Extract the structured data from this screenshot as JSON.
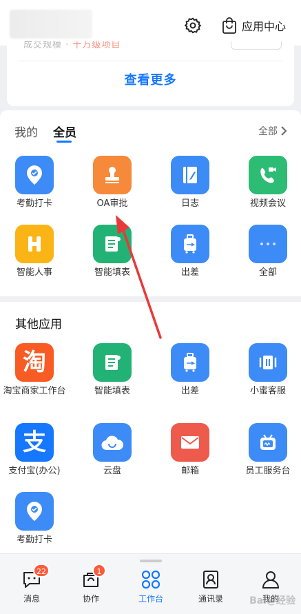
{
  "header": {
    "app_center_label": "应用中心"
  },
  "top_card": {
    "partial_text": "成交规模 · ",
    "partial_highlight": "千万级项目",
    "see_more": "查看更多"
  },
  "apps_section": {
    "tab_mine": "我的",
    "tab_all": "全员",
    "all_label": "全部",
    "apps": [
      {
        "label": "考勤打卡",
        "icon": "location-pin-icon",
        "color": "#3d8bf7"
      },
      {
        "label": "OA审批",
        "icon": "stamp-icon",
        "color": "#f7893a"
      },
      {
        "label": "日志",
        "icon": "notebook-icon",
        "color": "#3d8bf7"
      },
      {
        "label": "视频会议",
        "icon": "video-call-icon",
        "color": "#2cbc74"
      },
      {
        "label": "智能人事",
        "icon": "h-icon",
        "color": "#fbb416"
      },
      {
        "label": "智能填表",
        "icon": "form-icon",
        "color": "#22b275"
      },
      {
        "label": "出差",
        "icon": "luggage-icon",
        "color": "#3d8bf7"
      },
      {
        "label": "全部",
        "icon": "more-dots-icon",
        "color": "#3d8bf7"
      }
    ]
  },
  "other_section": {
    "title": "其他应用",
    "apps": [
      {
        "label": "淘宝商家工作台",
        "icon": "taobao-icon",
        "color": "#f95b24"
      },
      {
        "label": "智能填表",
        "icon": "form-icon",
        "color": "#22b275"
      },
      {
        "label": "出差",
        "icon": "luggage-icon",
        "color": "#3d8bf7"
      },
      {
        "label": "小蜜客服",
        "icon": "customer-service-icon",
        "color": "#3d8bf7"
      },
      {
        "label": "支付宝(办公)",
        "icon": "alipay-icon",
        "color": "#1677ff"
      },
      {
        "label": "云盘",
        "icon": "cloud-icon",
        "color": "#3d8bf7"
      },
      {
        "label": "邮箱",
        "icon": "mail-icon",
        "color": "#ee5a4c"
      },
      {
        "label": "员工服务台",
        "icon": "service-robot-icon",
        "color": "#3d8bf7"
      },
      {
        "label": "考勤打卡",
        "icon": "location-pin-icon",
        "color": "#3d8bf7"
      }
    ]
  },
  "bottom_nav": {
    "messages": {
      "label": "消息",
      "badge": "22"
    },
    "collab": {
      "label": "协作",
      "badge": "1"
    },
    "workbench": {
      "label": "工作台"
    },
    "contacts": {
      "label": "通讯录"
    },
    "me": {
      "label": "我的"
    }
  },
  "watermark": "Bai@经验",
  "colors": {
    "accent": "#1677ff",
    "badge": "#ff5a3c",
    "arrow": "#e8393a"
  }
}
